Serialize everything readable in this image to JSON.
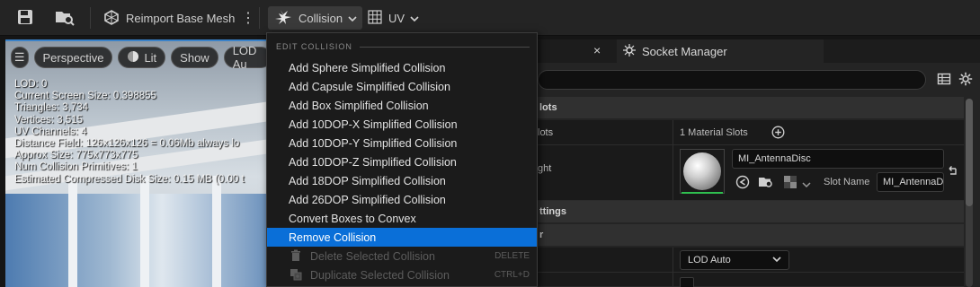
{
  "toolbar": {
    "reimport_label": "Reimport Base Mesh",
    "collision_label": "Collision",
    "uv_label": "UV"
  },
  "viewport": {
    "perspective_label": "Perspective",
    "lit_label": "Lit",
    "show_label": "Show",
    "lod_label": "LOD Au",
    "stats": [
      "LOD:  0",
      "Current Screen Size:  0.398855",
      "Triangles:  3,734",
      "Vertices:  3,515",
      "UV Channels:  4",
      "Distance Field:  126x126x126 = 0.06Mb always lo",
      "Approx Size: 775x773x775",
      "Num Collision Primitives:  1",
      "Estimated Compressed Disk Size: 0.15 MB (0.00 t"
    ]
  },
  "menu": {
    "section_title": "EDIT COLLISION",
    "items": [
      {
        "label": "Add Sphere Simplified Collision"
      },
      {
        "label": "Add Capsule Simplified Collision"
      },
      {
        "label": "Add Box Simplified Collision"
      },
      {
        "label": "Add 10DOP-X Simplified Collision"
      },
      {
        "label": "Add 10DOP-Y Simplified Collision"
      },
      {
        "label": "Add 10DOP-Z Simplified Collision"
      },
      {
        "label": "Add 18DOP Simplified Collision"
      },
      {
        "label": "Add 26DOP Simplified Collision"
      },
      {
        "label": "Convert Boxes to Convex"
      },
      {
        "label": "Remove Collision"
      },
      {
        "label": "Delete Selected Collision",
        "shortcut": "DELETE"
      },
      {
        "label": "Duplicate Selected Collision",
        "shortcut": "CTRL+D"
      }
    ]
  },
  "details": {
    "tab_close": "×",
    "socket_manager_tab": "Socket Manager",
    "category_material_slots": "lots",
    "row_slots_label": "lots",
    "material_slots_count": "1 Material Slots",
    "row_ght_label": "ght",
    "material_name": "MI_AntennaDisc",
    "slot_name_label": "Slot Name",
    "slot_name_value": "MI_AntennaD",
    "category_settings": "ttings",
    "category_r": "r",
    "lod_combo_value": "LOD Auto"
  },
  "colors": {
    "accent_blue": "#0a6fd8",
    "panel_bg": "#242424",
    "menu_bg": "#1b1b1b"
  }
}
